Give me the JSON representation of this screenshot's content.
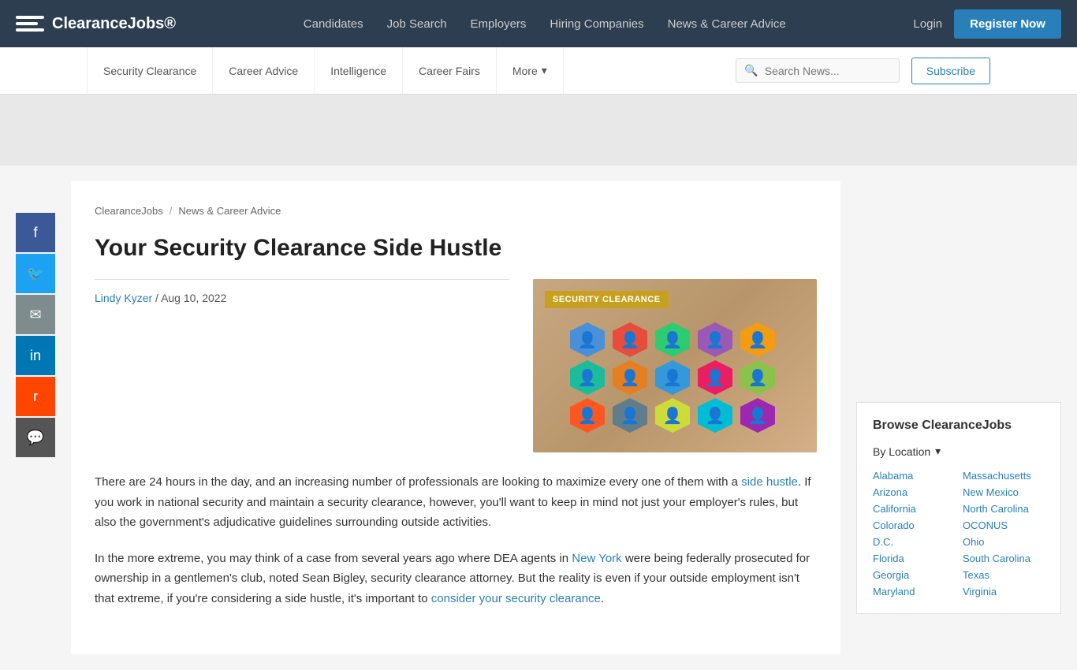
{
  "topNav": {
    "logo": "ClearanceJobs®",
    "links": [
      "Candidates",
      "Job Search",
      "Employers",
      "Hiring Companies",
      "News & Career Advice"
    ],
    "loginLabel": "Login",
    "registerLabel": "Register Now"
  },
  "subNav": {
    "links": [
      "Security Clearance",
      "Career Advice",
      "Intelligence",
      "Career Fairs"
    ],
    "moreLabel": "More",
    "searchPlaceholder": "Search News...",
    "subscribeLabel": "Subscribe"
  },
  "breadcrumb": {
    "home": "ClearanceJobs",
    "separator": "/",
    "section": "News & Career Advice"
  },
  "article": {
    "title": "Your Security Clearance Side Hustle",
    "author": "Lindy Kyzer",
    "date": "Aug 10, 2022",
    "imageBadge": "SECURITY CLEARANCE",
    "body1": "There are 24 hours in the day, and an increasing number of professionals are looking to maximize every one of them with a ",
    "body1Link": "side hustle",
    "body1Rest": ". If you work in national security and maintain a security clearance, however, you'll want to keep in mind not just your employer's rules, but also the government's adjudicative guidelines surrounding outside activities.",
    "body2": "In the more extreme, you may think of a case from several years ago where DEA agents in ",
    "body2Link": "New York",
    "body2Rest": " were being federally prosecuted for ownership in a gentlemen's club, noted Sean Bigley, security clearance attorney. But the reality is even if your outside employment isn't that extreme, if you're considering a side hustle, it's important to ",
    "body2Link2": "consider your security clearance",
    "body2End": "."
  },
  "socialButtons": [
    "f",
    "t",
    "✉",
    "in",
    "r",
    "💬"
  ],
  "sidebar": {
    "browseTitle": "Browse ClearanceJobs",
    "byLocationLabel": "By Location",
    "locations": [
      [
        "Alabama",
        "Massachusetts"
      ],
      [
        "Arizona",
        "New Mexico"
      ],
      [
        "California",
        "North Carolina"
      ],
      [
        "Colorado",
        "OCONUS"
      ],
      [
        "D.C.",
        "Ohio"
      ],
      [
        "Florida",
        "South Carolina"
      ],
      [
        "Georgia",
        "Texas"
      ],
      [
        "Maryland",
        "Virginia"
      ]
    ]
  }
}
